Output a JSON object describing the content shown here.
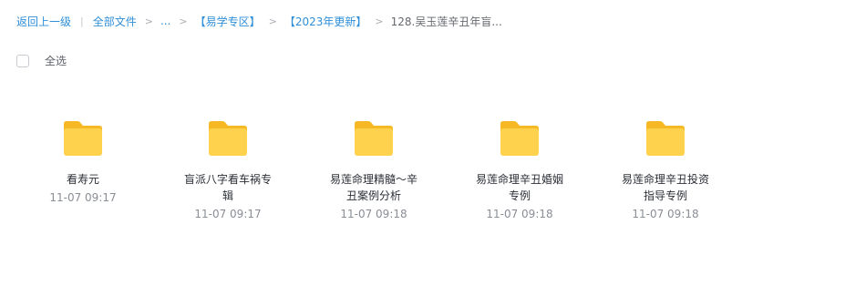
{
  "breadcrumb": {
    "back": "返回上一级",
    "bar": "|",
    "all_files": "全部文件",
    "gt": ">",
    "ellipsis": "...",
    "level1": "【易学专区】",
    "level2": "【2023年更新】",
    "current": "128.吴玉莲辛丑年盲..."
  },
  "select_all": {
    "label": "全选"
  },
  "folders": [
    {
      "name": "看寿元",
      "time": "11-07 09:17"
    },
    {
      "name": "盲派八字看车祸专辑",
      "time": "11-07 09:17"
    },
    {
      "name": "易莲命理精髓～辛丑案例分析",
      "time": "11-07 09:18"
    },
    {
      "name": "易莲命理辛丑婚姻专例",
      "time": "11-07 09:18"
    },
    {
      "name": "易莲命理辛丑投资指导专例",
      "time": "11-07 09:18"
    }
  ],
  "colors": {
    "link": "#2f8fd8",
    "folder_back": "#f6b825",
    "folder_front": "#ffd24d"
  },
  "icons": {
    "folder": "folder-icon",
    "checkbox": "checkbox-icon"
  }
}
